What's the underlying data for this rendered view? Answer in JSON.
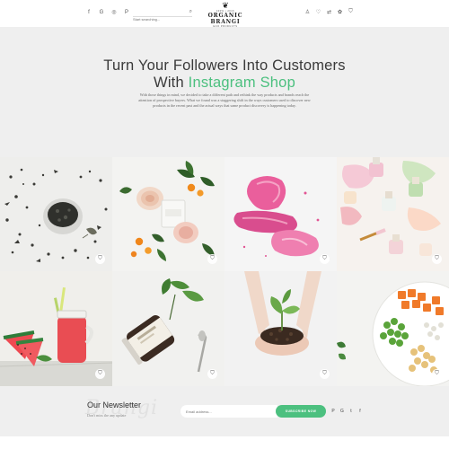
{
  "header": {
    "social_icons": [
      "facebook-icon",
      "google-plus-icon",
      "instagram-icon",
      "pinterest-icon"
    ],
    "search_placeholder": "Start searching...",
    "logo": {
      "top": "100% • 2016",
      "name": "ORGANIC BRANGI",
      "tagline": "ECO PRODUCTS"
    },
    "action_icons": [
      "user-icon",
      "heart-icon",
      "compare-icon",
      "wishlist-icon",
      "cart-icon"
    ]
  },
  "hero": {
    "title_line1": "Turn Your Followers Into Customers",
    "title_with": "With",
    "title_accent": "Instagram Shop",
    "body": "With those things in mind, we decided to take a different path and rethink the way products and brands reach the attention of prospective buyers. What we found was a staggering shift in the ways customers used to discover new products in the recent past and the actual ways that same product discovery is happening today."
  },
  "tiles": [
    {
      "subject": "tea-leaves"
    },
    {
      "subject": "candle-and-flowers"
    },
    {
      "subject": "pink-makeup"
    },
    {
      "subject": "nail-polish"
    },
    {
      "subject": "watermelon-juice"
    },
    {
      "subject": "herb-jar"
    },
    {
      "subject": "seedling-in-hands"
    },
    {
      "subject": "vegetable-plate"
    }
  ],
  "newsletter": {
    "watermark": "Brangi",
    "title": "Our Newsletter",
    "subtitle": "Don't miss the any update",
    "email_placeholder": "Email address...",
    "button_label": "SUBSCRIBE NOW",
    "social_icons": [
      "pinterest-icon",
      "google-plus-icon",
      "twitter-icon",
      "facebook-icon"
    ]
  },
  "colors": {
    "accent": "#4cc07f",
    "hero_bg": "#efefef"
  }
}
